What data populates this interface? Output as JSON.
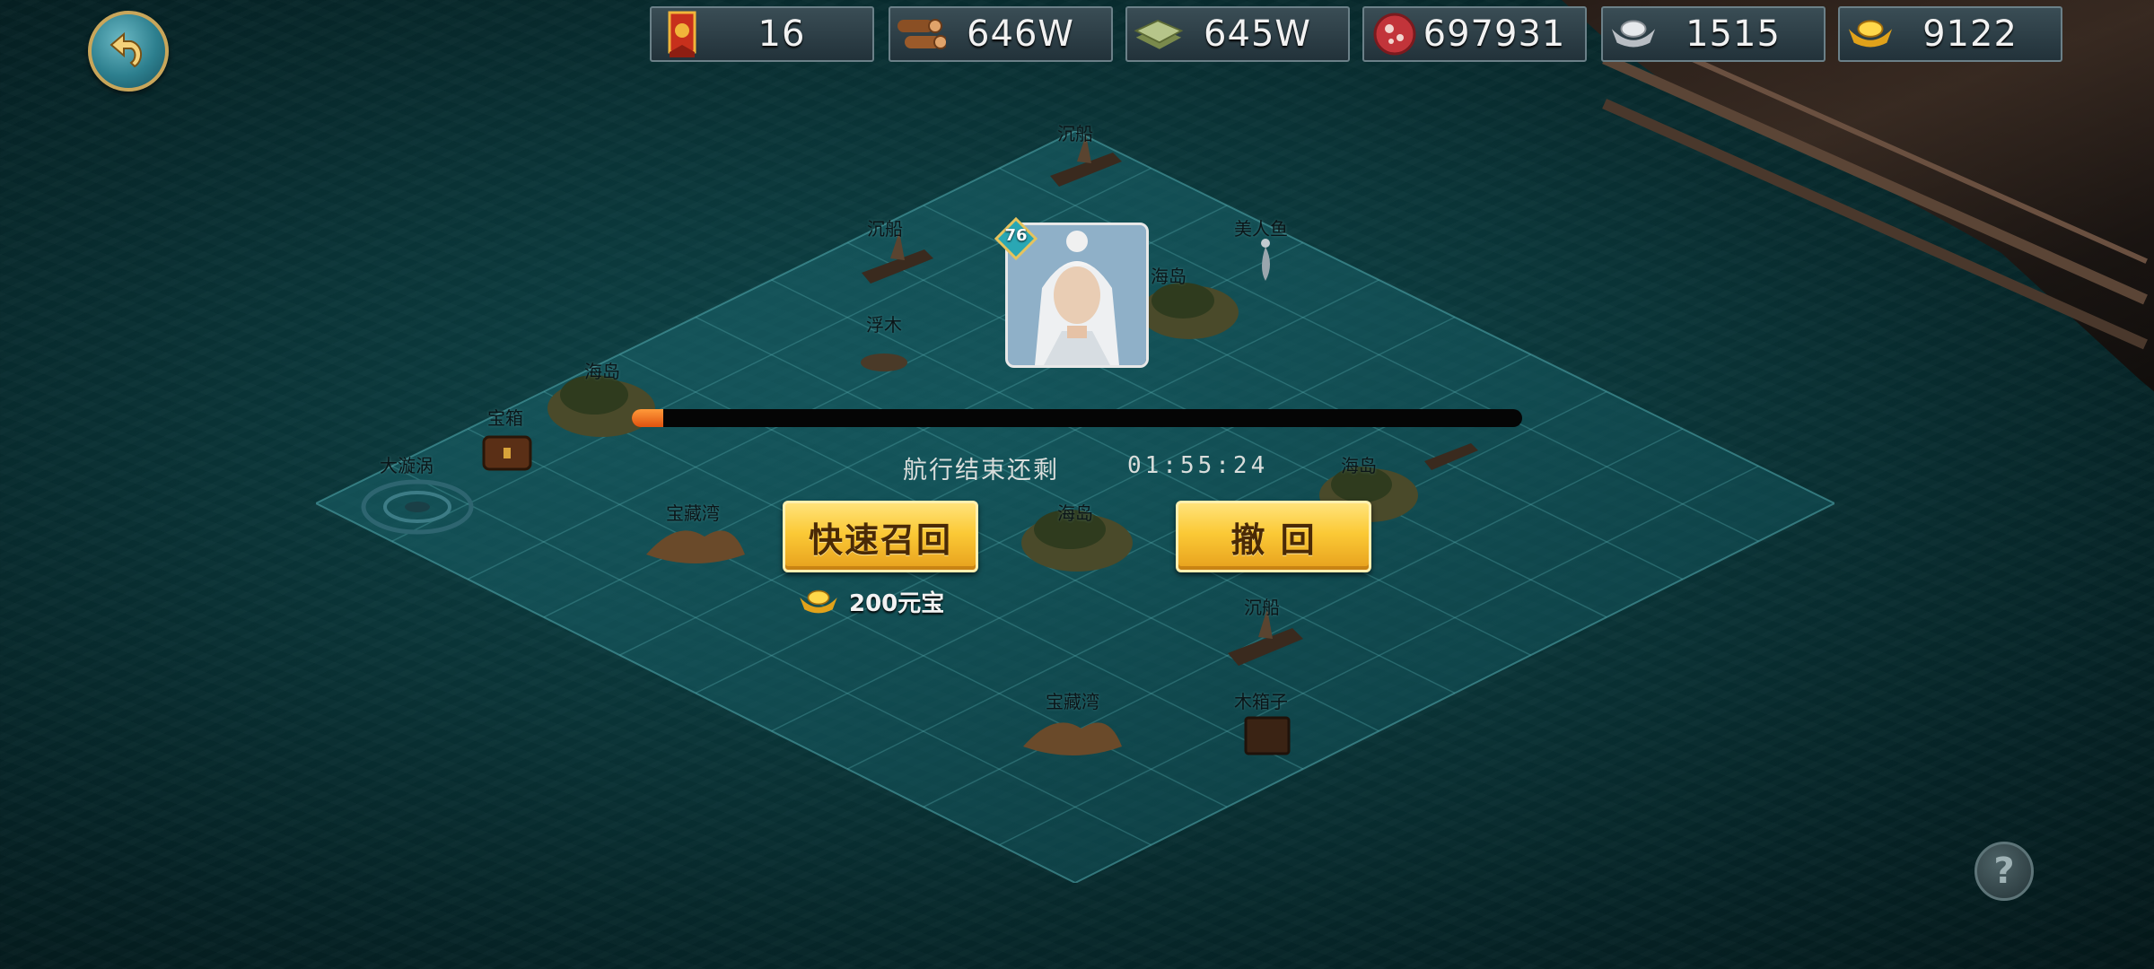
{
  "resources": [
    {
      "id": "token",
      "icon": "banner-icon",
      "value": "16"
    },
    {
      "id": "wood",
      "icon": "wood-logs-icon",
      "value": "646W"
    },
    {
      "id": "stone",
      "icon": "stone-slab-icon",
      "value": "645W"
    },
    {
      "id": "meat",
      "icon": "meat-icon",
      "value": "697931"
    },
    {
      "id": "silver",
      "icon": "silver-ingot-icon",
      "value": "1515"
    },
    {
      "id": "gold",
      "icon": "gold-ingot-icon",
      "value": "9122"
    }
  ],
  "map_labels": [
    {
      "id": "shipwreck-top",
      "text": "沉船"
    },
    {
      "id": "shipwreck-left",
      "text": "沉船"
    },
    {
      "id": "mermaid",
      "text": "美人鱼"
    },
    {
      "id": "island-top",
      "text": "海岛"
    },
    {
      "id": "driftwood",
      "text": "浮木"
    },
    {
      "id": "island-left",
      "text": "海岛"
    },
    {
      "id": "treasure-chest",
      "text": "宝箱"
    },
    {
      "id": "whirlpool",
      "text": "大漩涡"
    },
    {
      "id": "treasure-bay-left",
      "text": "宝藏湾"
    },
    {
      "id": "island-center",
      "text": "海岛"
    },
    {
      "id": "island-right",
      "text": "海岛"
    },
    {
      "id": "shipwreck-bottom",
      "text": "沉船"
    },
    {
      "id": "treasure-bay-bottom",
      "text": "宝藏湾"
    },
    {
      "id": "wooden-box",
      "text": "木箱子"
    }
  ],
  "hero": {
    "level": "76"
  },
  "voyage": {
    "progress": 0.035,
    "remaining_label": "航行结束还剩",
    "remaining_time": "01:55:24"
  },
  "buttons": {
    "quick_recall": "快速召回",
    "withdraw": "撤 回"
  },
  "cost": {
    "text": "200元宝"
  },
  "help": {
    "label": "?"
  },
  "colors": {
    "accent_gold": "#fbc936",
    "progress": "#e0520f",
    "sea": "#0a3437"
  }
}
